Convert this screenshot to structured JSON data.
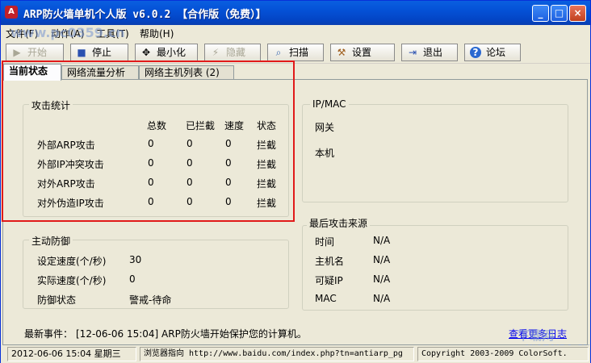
{
  "window": {
    "title": "ARP防火墙单机个人版 v6.0.2 【合作版（免费）】",
    "title_icon_glyph": "A",
    "minimize_glyph": "_",
    "maximize_glyph": "□",
    "close_glyph": "×"
  },
  "menu": [
    {
      "label": "文件(F)"
    },
    {
      "label": "动作(A)"
    },
    {
      "label": "工具(T)"
    },
    {
      "label": "帮助(H)"
    }
  ],
  "toolbar": [
    {
      "label": "开始",
      "icon": "play-icon",
      "glyph": "▶",
      "disabled": true
    },
    {
      "label": "停止",
      "icon": "stop-icon",
      "glyph": "■",
      "disabled": false
    },
    {
      "label": "最小化",
      "icon": "minimize-icon",
      "glyph": "✥",
      "disabled": false
    },
    {
      "label": "隐藏",
      "icon": "hide-icon",
      "glyph": "⚡",
      "disabled": true
    },
    {
      "label": "扫描",
      "icon": "magnifier-icon",
      "glyph": "⌕",
      "disabled": false
    },
    {
      "label": "设置",
      "icon": "wrench-icon",
      "glyph": "⚒",
      "disabled": false
    },
    {
      "label": "退出",
      "icon": "exit-icon",
      "glyph": "⇥",
      "disabled": false
    },
    {
      "label": "论坛",
      "icon": "help-icon",
      "glyph": "?",
      "disabled": false
    }
  ],
  "tabs": [
    {
      "label": "当前状态",
      "active": true
    },
    {
      "label": "网络流量分析",
      "active": false
    },
    {
      "label": "网络主机列表 (2)",
      "active": false
    }
  ],
  "attack_stats": {
    "title": "攻击统计",
    "columns": [
      "总数",
      "已拦截",
      "速度",
      "状态"
    ],
    "rows": [
      {
        "name": "外部ARP攻击",
        "total": "0",
        "blocked": "0",
        "speed": "0",
        "status": "拦截"
      },
      {
        "name": "外部IP冲突攻击",
        "total": "0",
        "blocked": "0",
        "speed": "0",
        "status": "拦截"
      },
      {
        "name": "对外ARP攻击",
        "total": "0",
        "blocked": "0",
        "speed": "0",
        "status": "拦截"
      },
      {
        "name": "对外伪造IP攻击",
        "total": "0",
        "blocked": "0",
        "speed": "0",
        "status": "拦截"
      }
    ]
  },
  "ipmac": {
    "title": "IP/MAC",
    "gateway_label": "网关",
    "local_label": "本机"
  },
  "active_defense": {
    "title": "主动防御",
    "set_speed_label": "设定速度(个/秒)",
    "set_speed_value": "30",
    "actual_speed_label": "实际速度(个/秒)",
    "actual_speed_value": "0",
    "state_label": "防御状态",
    "state_value": "警戒-待命"
  },
  "last_attack": {
    "title": "最后攻击来源",
    "rows": [
      {
        "label": "时间",
        "value": "N/A"
      },
      {
        "label": "主机名",
        "value": "N/A"
      },
      {
        "label": "可疑IP",
        "value": "N/A"
      },
      {
        "label": "MAC",
        "value": "N/A"
      }
    ]
  },
  "latest_event": {
    "label": "最新事件：",
    "text": "[12-06-06 15:04] ARP防火墙开始保护您的计算机。",
    "more_link": "查看更多日志"
  },
  "statusbar": {
    "datetime": "2012-06-06 15:04 星期三",
    "browser": "浏览器指向 http://www.baidu.com/index.php?tn=antiarp_pg",
    "copyright": "Copyright 2003-2009 ColorSoft."
  },
  "watermarks": {
    "top_left": "www.pc0359.cn",
    "bottom_right": "下载网",
    "bottom_right_url": "XIAZAIBA.CN"
  }
}
